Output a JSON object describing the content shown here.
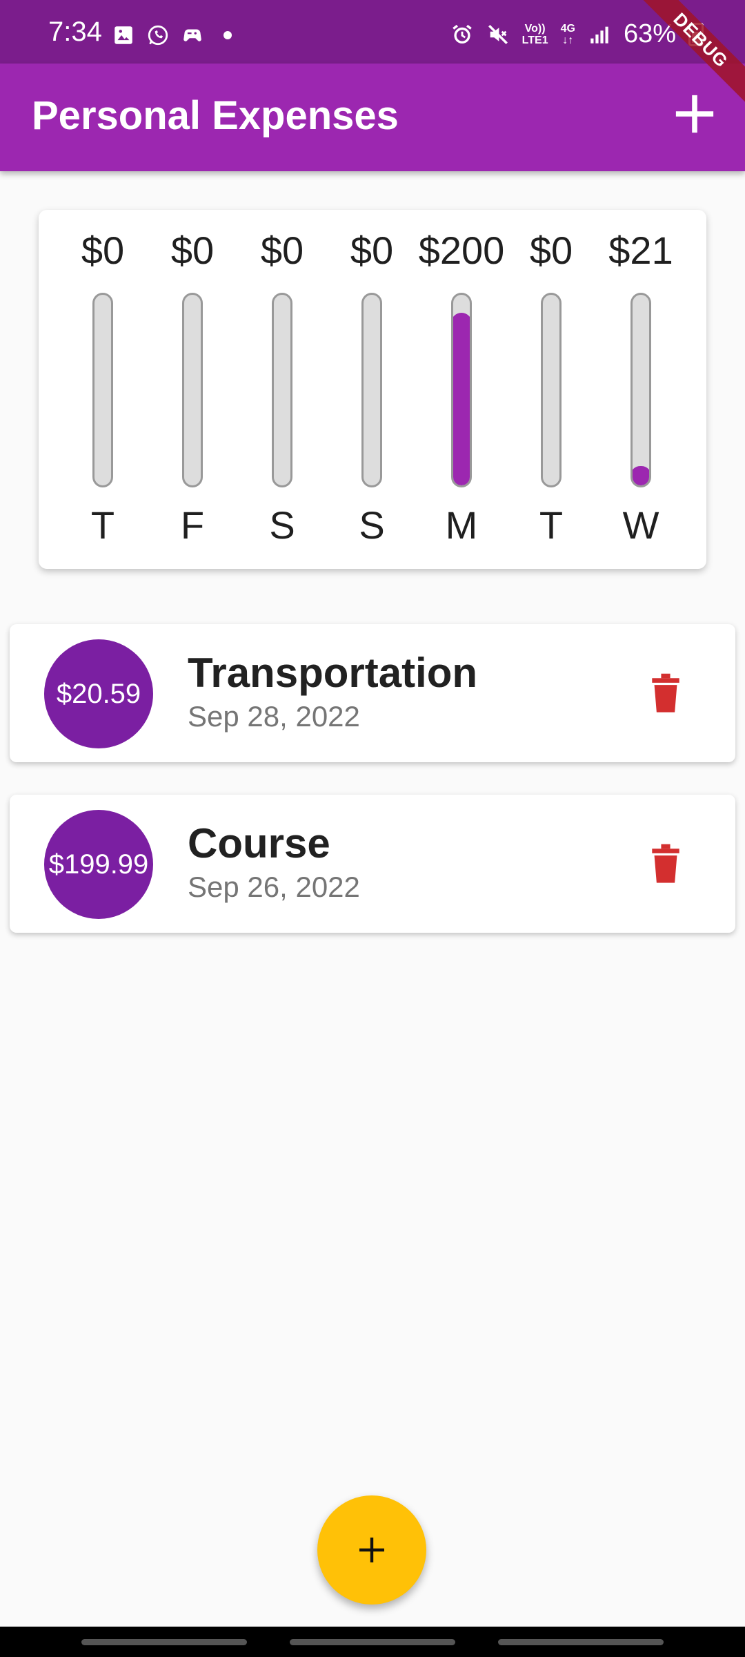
{
  "status_bar": {
    "time": "7:34",
    "network": "4G",
    "volte_line1": "Vo))",
    "volte_line2": "LTE1",
    "battery": "63%"
  },
  "debug_banner": "DEBUG",
  "app_bar": {
    "title": "Personal Expenses",
    "add_icon": "plus-icon"
  },
  "chart_data": {
    "type": "bar",
    "categories": [
      "T",
      "F",
      "S",
      "S",
      "M",
      "T",
      "W"
    ],
    "values": [
      0,
      0,
      0,
      0,
      200,
      0,
      21
    ],
    "value_labels": [
      "$0",
      "$0",
      "$0",
      "$0",
      "$200",
      "$0",
      "$21"
    ],
    "spending_fraction": [
      0,
      0,
      0,
      0,
      0.907,
      0,
      0.093
    ]
  },
  "transactions": [
    {
      "amount": "$20.59",
      "title": "Transportation",
      "date": "Sep 28, 2022"
    },
    {
      "amount": "$199.99",
      "title": "Course",
      "date": "Sep 26, 2022"
    }
  ],
  "fab_icon": "plus-icon",
  "colors": {
    "primary": "#9c27b0",
    "status_bar": "#7b1d8c",
    "accent": "#ffc107",
    "delete": "#d32f2f"
  }
}
